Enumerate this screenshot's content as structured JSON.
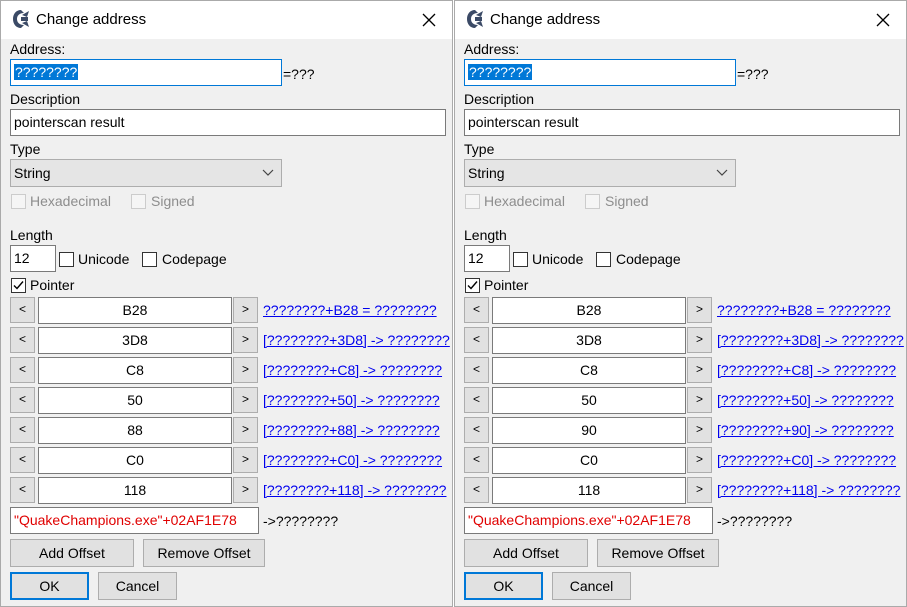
{
  "left": {
    "title": "Change address",
    "address_label": "Address:",
    "address_value": "????????",
    "address_eval": "=???",
    "description_label": "Description",
    "description_value": "pointerscan result",
    "type_label": "Type",
    "type_value": "String",
    "hexadecimal_label": "Hexadecimal",
    "signed_label": "Signed",
    "length_label": "Length",
    "length_value": "12",
    "unicode_label": "Unicode",
    "codepage_label": "Codepage",
    "pointer_label": "Pointer",
    "offsets": [
      {
        "prev": "<",
        "value": "B28",
        "next": ">",
        "result": "????????+B28 = ????????"
      },
      {
        "prev": "<",
        "value": "3D8",
        "next": ">",
        "result": "[????????+3D8] -> ????????"
      },
      {
        "prev": "<",
        "value": "C8",
        "next": ">",
        "result": "[????????+C8] -> ????????"
      },
      {
        "prev": "<",
        "value": "50",
        "next": ">",
        "result": "[????????+50] -> ????????"
      },
      {
        "prev": "<",
        "value": "88",
        "next": ">",
        "result": "[????????+88] -> ????????"
      },
      {
        "prev": "<",
        "value": "C0",
        "next": ">",
        "result": "[????????+C0] -> ????????"
      },
      {
        "prev": "<",
        "value": "118",
        "next": ">",
        "result": "[????????+118] -> ????????"
      }
    ],
    "base_address": "\"QuakeChampions.exe\"+02AF1E78",
    "base_result": "->????????",
    "add_offset": "Add Offset",
    "remove_offset": "Remove Offset",
    "ok": "OK",
    "cancel": "Cancel"
  },
  "right": {
    "title": "Change address",
    "address_label": "Address:",
    "address_value": "????????",
    "address_eval": "=???",
    "description_label": "Description",
    "description_value": "pointerscan result",
    "type_label": "Type",
    "type_value": "String",
    "hexadecimal_label": "Hexadecimal",
    "signed_label": "Signed",
    "length_label": "Length",
    "length_value": "12",
    "unicode_label": "Unicode",
    "codepage_label": "Codepage",
    "pointer_label": "Pointer",
    "offsets": [
      {
        "prev": "<",
        "value": "B28",
        "next": ">",
        "result": "????????+B28 = ????????"
      },
      {
        "prev": "<",
        "value": "3D8",
        "next": ">",
        "result": "[????????+3D8] -> ????????"
      },
      {
        "prev": "<",
        "value": "C8",
        "next": ">",
        "result": "[????????+C8] -> ????????"
      },
      {
        "prev": "<",
        "value": "50",
        "next": ">",
        "result": "[????????+50] -> ????????"
      },
      {
        "prev": "<",
        "value": "90",
        "next": ">",
        "result": "[????????+90] -> ????????"
      },
      {
        "prev": "<",
        "value": "C0",
        "next": ">",
        "result": "[????????+C0] -> ????????"
      },
      {
        "prev": "<",
        "value": "118",
        "next": ">",
        "result": "[????????+118] -> ????????"
      }
    ],
    "base_address": "\"QuakeChampions.exe\"+02AF1E78",
    "base_result": "->????????",
    "add_offset": "Add Offset",
    "remove_offset": "Remove Offset",
    "ok": "OK",
    "cancel": "Cancel"
  },
  "icons": [
    "cheat-engine-icon",
    "close-icon",
    "chevron-down-icon",
    "checkmark-icon"
  ],
  "colors": {
    "selection": "#0078d7",
    "link": "#0000ee",
    "base_address_text": "#e00000",
    "window_bg": "#f0f0f0"
  }
}
